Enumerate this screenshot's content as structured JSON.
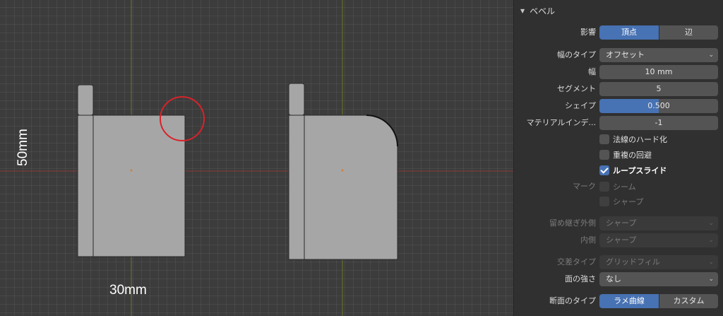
{
  "viewport": {
    "dim_height": "50mm",
    "dim_width": "30mm",
    "axis_x_color": "#8a3a3a",
    "axis_y_color": "#6a7a2a",
    "mesh_color": "#a6a6a6",
    "highlight_color": "#d8232a"
  },
  "panel": {
    "header": "ベベル",
    "affect": {
      "label": "影響",
      "options": [
        "頂点",
        "辺"
      ],
      "selected": "頂点"
    },
    "width_type": {
      "label": "幅のタイプ",
      "value": "オフセット"
    },
    "width": {
      "label": "幅",
      "value": "10 mm"
    },
    "segments": {
      "label": "セグメント",
      "value": "5"
    },
    "shape": {
      "label": "シェイプ",
      "value": "0.500",
      "fraction": 0.5
    },
    "material_index": {
      "label": "マテリアルインデ...",
      "value": "-1"
    },
    "harden_normals": {
      "label": "法線のハード化",
      "checked": false
    },
    "clamp_overlap": {
      "label": "重複の回避",
      "checked": false
    },
    "loop_slide": {
      "label": "ループスライド",
      "checked": true
    },
    "mark": {
      "label": "マーク",
      "seam": "シーム",
      "sharp": "シャープ"
    },
    "miter_outer": {
      "label": "留め継ぎ外側",
      "value": "シャープ"
    },
    "miter_inner": {
      "label": "内側",
      "value": "シャープ"
    },
    "intersection_type": {
      "label": "交差タイプ",
      "value": "グリッドフィル"
    },
    "face_strength": {
      "label": "面の強さ",
      "value": "なし"
    },
    "profile_type": {
      "label": "断面のタイプ",
      "options": [
        "ラメ曲線",
        "カスタム"
      ],
      "selected": "ラメ曲線"
    }
  }
}
